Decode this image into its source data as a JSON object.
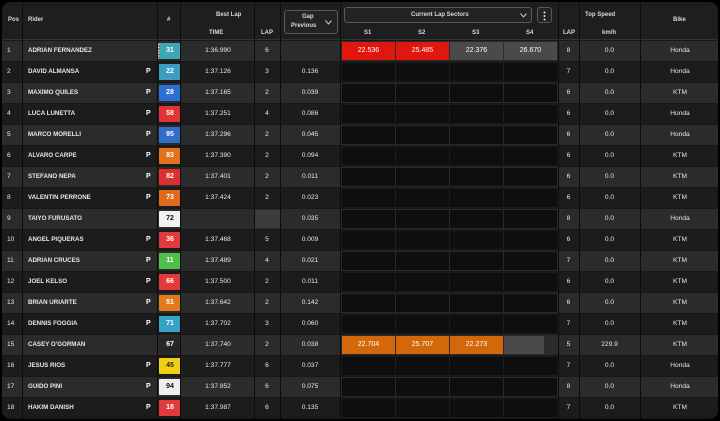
{
  "header": {
    "pos": "Pos",
    "rider": "Rider",
    "number": "#",
    "best_lap": "Best Lap",
    "time": "TIME",
    "lap": "LAP",
    "gap_line1": "Gap",
    "gap_line2": "Previous",
    "sectors_title": "Current Lap Sectors",
    "s1": "S1",
    "s2": "S2",
    "s3": "S3",
    "s4": "S4",
    "sector_lap": "LAP",
    "top_speed": "Top Speed",
    "kmh": "km/h",
    "bike": "Bike",
    "more_icon": "more-vertical-icon",
    "dropdown_icon": "chevron-down-icon"
  },
  "colors": {
    "purple_sector": "#e0170f",
    "orange_sector": "#d3680a",
    "grey_sector": "#4a4a4a"
  },
  "rows": [
    {
      "pos": "1",
      "rider": "ADRIAN FERNANDEZ",
      "num": "31",
      "num_bg": "#3ea6b4",
      "num_fg": "#ffffff",
      "flag": true,
      "p": "",
      "best": "1:36.990",
      "lap": "6",
      "gap": "",
      "s1": "22.536",
      "s1c": "red",
      "s2": "25.485",
      "s2c": "red",
      "s3": "22.376",
      "s3c": "grey",
      "s4": "26.670",
      "s4c": "grey",
      "slap": "8",
      "speed": "0.0",
      "bike": "Honda"
    },
    {
      "pos": "2",
      "rider": "DAVID ALMANSA",
      "num": "22",
      "num_bg": "#3e9cc0",
      "num_fg": "#ffffff",
      "flag": false,
      "p": "P",
      "best": "1:37.126",
      "lap": "3",
      "gap": "0.136",
      "s1": "",
      "s1c": "empty",
      "s2": "",
      "s2c": "empty",
      "s3": "",
      "s3c": "empty",
      "s4": "",
      "s4c": "empty",
      "slap": "7",
      "speed": "0.0",
      "bike": "Honda"
    },
    {
      "pos": "3",
      "rider": "MAXIMO QUILES",
      "num": "28",
      "num_bg": "#2a6fd4",
      "num_fg": "#ffffff",
      "flag": false,
      "p": "P",
      "best": "1:37.165",
      "lap": "2",
      "gap": "0.039",
      "s1": "",
      "s1c": "empty",
      "s2": "",
      "s2c": "empty",
      "s3": "",
      "s3c": "empty",
      "s4": "",
      "s4c": "empty",
      "slap": "6",
      "speed": "0.0",
      "bike": "KTM"
    },
    {
      "pos": "4",
      "rider": "LUCA LUNETTA",
      "num": "58",
      "num_bg": "#e23434",
      "num_fg": "#ffffff",
      "flag": false,
      "p": "P",
      "best": "1:37.251",
      "lap": "4",
      "gap": "0.086",
      "s1": "",
      "s1c": "empty",
      "s2": "",
      "s2c": "empty",
      "s3": "",
      "s3c": "empty",
      "s4": "",
      "s4c": "empty",
      "slap": "6",
      "speed": "0.0",
      "bike": "Honda"
    },
    {
      "pos": "5",
      "rider": "MARCO MORELLI",
      "num": "95",
      "num_bg": "#2f6fc8",
      "num_fg": "#ffffff",
      "flag": false,
      "p": "P",
      "best": "1:37.296",
      "lap": "2",
      "gap": "0.045",
      "s1": "",
      "s1c": "empty",
      "s2": "",
      "s2c": "empty",
      "s3": "",
      "s3c": "empty",
      "s4": "",
      "s4c": "empty",
      "slap": "6",
      "speed": "0.0",
      "bike": "Honda"
    },
    {
      "pos": "6",
      "rider": "ALVARO CARPE",
      "num": "83",
      "num_bg": "#e0731c",
      "num_fg": "#ffffff",
      "flag": false,
      "p": "P",
      "best": "1:37.390",
      "lap": "2",
      "gap": "0.094",
      "s1": "",
      "s1c": "empty",
      "s2": "",
      "s2c": "empty",
      "s3": "",
      "s3c": "empty",
      "s4": "",
      "s4c": "empty",
      "slap": "6",
      "speed": "0.0",
      "bike": "KTM"
    },
    {
      "pos": "7",
      "rider": "STEFANO NEPA",
      "num": "82",
      "num_bg": "#dc3030",
      "num_fg": "#ffffff",
      "flag": false,
      "p": "P",
      "best": "1:37.401",
      "lap": "2",
      "gap": "0.011",
      "s1": "",
      "s1c": "empty",
      "s2": "",
      "s2c": "empty",
      "s3": "",
      "s3c": "empty",
      "s4": "",
      "s4c": "empty",
      "slap": "6",
      "speed": "0.0",
      "bike": "KTM"
    },
    {
      "pos": "8",
      "rider": "VALENTIN PERRONE",
      "num": "73",
      "num_bg": "#e06a1a",
      "num_fg": "#ffffff",
      "flag": false,
      "p": "P",
      "best": "1:37.424",
      "lap": "2",
      "gap": "0.023",
      "s1": "",
      "s1c": "empty",
      "s2": "",
      "s2c": "empty",
      "s3": "",
      "s3c": "empty",
      "s4": "",
      "s4c": "empty",
      "slap": "6",
      "speed": "0.0",
      "bike": "KTM"
    },
    {
      "pos": "9",
      "rider": "TAIYO FURUSATO",
      "num": "72",
      "num_bg": "#f2f2f2",
      "num_fg": "#111111",
      "flag": false,
      "p": "",
      "best": "",
      "lap": "",
      "gap": "0.035",
      "s1": "",
      "s1c": "empty",
      "s2": "",
      "s2c": "empty",
      "s3": "",
      "s3c": "empty",
      "s4": "",
      "s4c": "empty",
      "slap": "8",
      "speed": "0.0",
      "bike": "Honda"
    },
    {
      "pos": "10",
      "rider": "ANGEL PIQUERAS",
      "num": "36",
      "num_bg": "#e03a3a",
      "num_fg": "#ffffff",
      "flag": false,
      "p": "P",
      "best": "1:37.468",
      "lap": "5",
      "gap": "0.009",
      "s1": "",
      "s1c": "empty",
      "s2": "",
      "s2c": "empty",
      "s3": "",
      "s3c": "empty",
      "s4": "",
      "s4c": "empty",
      "slap": "6",
      "speed": "0.0",
      "bike": "KTM"
    },
    {
      "pos": "11",
      "rider": "ADRIAN CRUCES",
      "num": "11",
      "num_bg": "#4fbf4a",
      "num_fg": "#ffffff",
      "flag": false,
      "p": "P",
      "best": "1:37.489",
      "lap": "4",
      "gap": "0.021",
      "s1": "",
      "s1c": "empty",
      "s2": "",
      "s2c": "empty",
      "s3": "",
      "s3c": "empty",
      "s4": "",
      "s4c": "empty",
      "slap": "7",
      "speed": "0.0",
      "bike": "KTM"
    },
    {
      "pos": "12",
      "rider": "JOEL KELSO",
      "num": "66",
      "num_bg": "#e23a3a",
      "num_fg": "#ffffff",
      "flag": false,
      "p": "P",
      "best": "1:37.500",
      "lap": "2",
      "gap": "0.011",
      "s1": "",
      "s1c": "empty",
      "s2": "",
      "s2c": "empty",
      "s3": "",
      "s3c": "empty",
      "s4": "",
      "s4c": "empty",
      "slap": "6",
      "speed": "0.0",
      "bike": "KTM"
    },
    {
      "pos": "13",
      "rider": "BRIAN URIARTE",
      "num": "51",
      "num_bg": "#e07a1a",
      "num_fg": "#ffffff",
      "flag": false,
      "p": "P",
      "best": "1:37.642",
      "lap": "2",
      "gap": "0.142",
      "s1": "",
      "s1c": "empty",
      "s2": "",
      "s2c": "empty",
      "s3": "",
      "s3c": "empty",
      "s4": "",
      "s4c": "empty",
      "slap": "6",
      "speed": "0.0",
      "bike": "KTM"
    },
    {
      "pos": "14",
      "rider": "DENNIS FOGGIA",
      "num": "71",
      "num_bg": "#35a3c8",
      "num_fg": "#ffffff",
      "flag": false,
      "p": "P",
      "best": "1:37.702",
      "lap": "3",
      "gap": "0.060",
      "s1": "",
      "s1c": "empty",
      "s2": "",
      "s2c": "empty",
      "s3": "",
      "s3c": "empty",
      "s4": "",
      "s4c": "empty",
      "slap": "7",
      "speed": "0.0",
      "bike": "KTM"
    },
    {
      "pos": "15",
      "rider": "CASEY O'GORMAN",
      "num": "67",
      "num_bg": "#262626",
      "num_fg": "#ffffff",
      "flag": false,
      "p": "",
      "best": "1:37.740",
      "lap": "2",
      "gap": "0.038",
      "s1": "22.704",
      "s1c": "orange",
      "s2": "25.707",
      "s2c": "orange",
      "s3": "22.273",
      "s3c": "orange",
      "s4": "",
      "s4c": "grey",
      "slap": "5",
      "speed": "229.9",
      "bike": "KTM"
    },
    {
      "pos": "16",
      "rider": "JESUS RIOS",
      "num": "45",
      "num_bg": "#f2cf16",
      "num_fg": "#222222",
      "flag": false,
      "p": "P",
      "best": "1:37.777",
      "lap": "6",
      "gap": "0.037",
      "s1": "",
      "s1c": "empty",
      "s2": "",
      "s2c": "empty",
      "s3": "",
      "s3c": "empty",
      "s4": "",
      "s4c": "empty",
      "slap": "7",
      "speed": "0.0",
      "bike": "Honda"
    },
    {
      "pos": "17",
      "rider": "GUIDO PINI",
      "num": "94",
      "num_bg": "#efefef",
      "num_fg": "#111111",
      "flag": false,
      "p": "P",
      "best": "1:37.852",
      "lap": "6",
      "gap": "0.075",
      "s1": "",
      "s1c": "empty",
      "s2": "",
      "s2c": "empty",
      "s3": "",
      "s3c": "empty",
      "s4": "",
      "s4c": "empty",
      "slap": "8",
      "speed": "0.0",
      "bike": "Honda"
    },
    {
      "pos": "18",
      "rider": "HAKIM DANISH",
      "num": "18",
      "num_bg": "#e03a3a",
      "num_fg": "#ffffff",
      "flag": false,
      "p": "P",
      "best": "1:37.987",
      "lap": "6",
      "gap": "0.135",
      "s1": "",
      "s1c": "empty",
      "s2": "",
      "s2c": "empty",
      "s3": "",
      "s3c": "empty",
      "s4": "",
      "s4c": "empty",
      "slap": "7",
      "speed": "0.0",
      "bike": "KTM"
    }
  ]
}
